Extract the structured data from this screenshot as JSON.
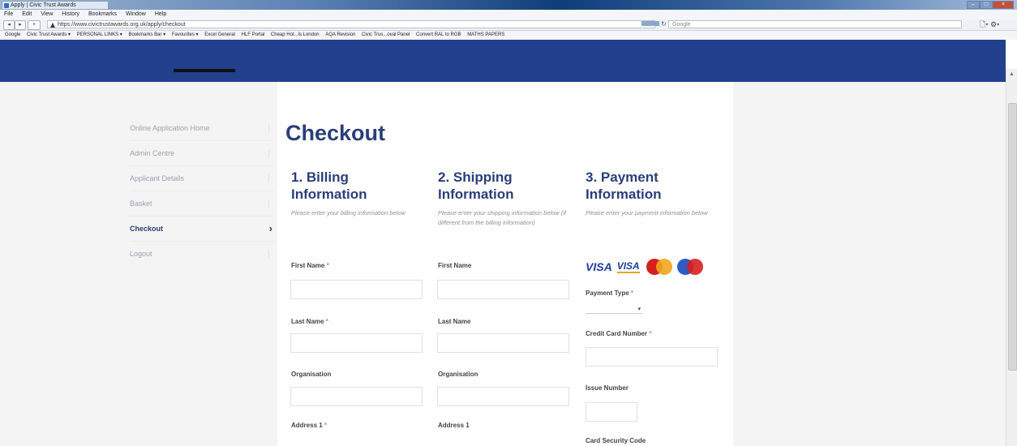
{
  "browser": {
    "tab_title": "Apply | Civic Trust Awards",
    "menu": [
      "File",
      "Edit",
      "View",
      "History",
      "Bookmarks",
      "Window",
      "Help"
    ],
    "url": "https://www.civictrustawards.org.uk/apply/checkout",
    "search_placeholder": "Google",
    "bookmarks": [
      "Google",
      "Civic Trust Awards ▾",
      "PERSONAL LINKS ▾",
      "Bookmarks Bar ▾",
      "Favourites ▾",
      "Excel General",
      "HLF Portal",
      "Cheap Hot...ls London",
      "AQA Revision",
      "Civic Trus...oval Panel",
      "Convert RAL to RGB",
      "MATHS PAPERS"
    ]
  },
  "sidebar": {
    "items": [
      {
        "label": "Online Application Home"
      },
      {
        "label": "Admin Centre"
      },
      {
        "label": "Applicant Details"
      },
      {
        "label": "Basket"
      },
      {
        "label": "Checkout"
      },
      {
        "label": "Logout"
      }
    ],
    "active_index": 4
  },
  "checkout": {
    "title": "Checkout",
    "billing": {
      "heading": "1. Billing Information",
      "description": "Please enter your billing information below",
      "fields": [
        "First Name",
        "Last Name",
        "Organisation",
        "Address 1"
      ],
      "required": [
        true,
        true,
        false,
        true
      ]
    },
    "shipping": {
      "heading": "2. Shipping Information",
      "description": "Please enter your shipping information below (if different from the billing information)",
      "fields": [
        "First Name",
        "Last Name",
        "Organisation",
        "Address 1"
      ]
    },
    "payment": {
      "heading": "3. Payment Information",
      "description": "Please enter your payment information below",
      "cards": [
        "VISA",
        "VISA",
        "mastercard-icon",
        "maestro-icon"
      ],
      "payment_type_label": "Payment Type",
      "card_number_label": "Credit Card Number",
      "issue_number_label": "Issue Number",
      "security_code_label": "Card Security Code"
    }
  },
  "colors": {
    "brand_navy": "#22408c",
    "heading": "#2a3e7a"
  }
}
